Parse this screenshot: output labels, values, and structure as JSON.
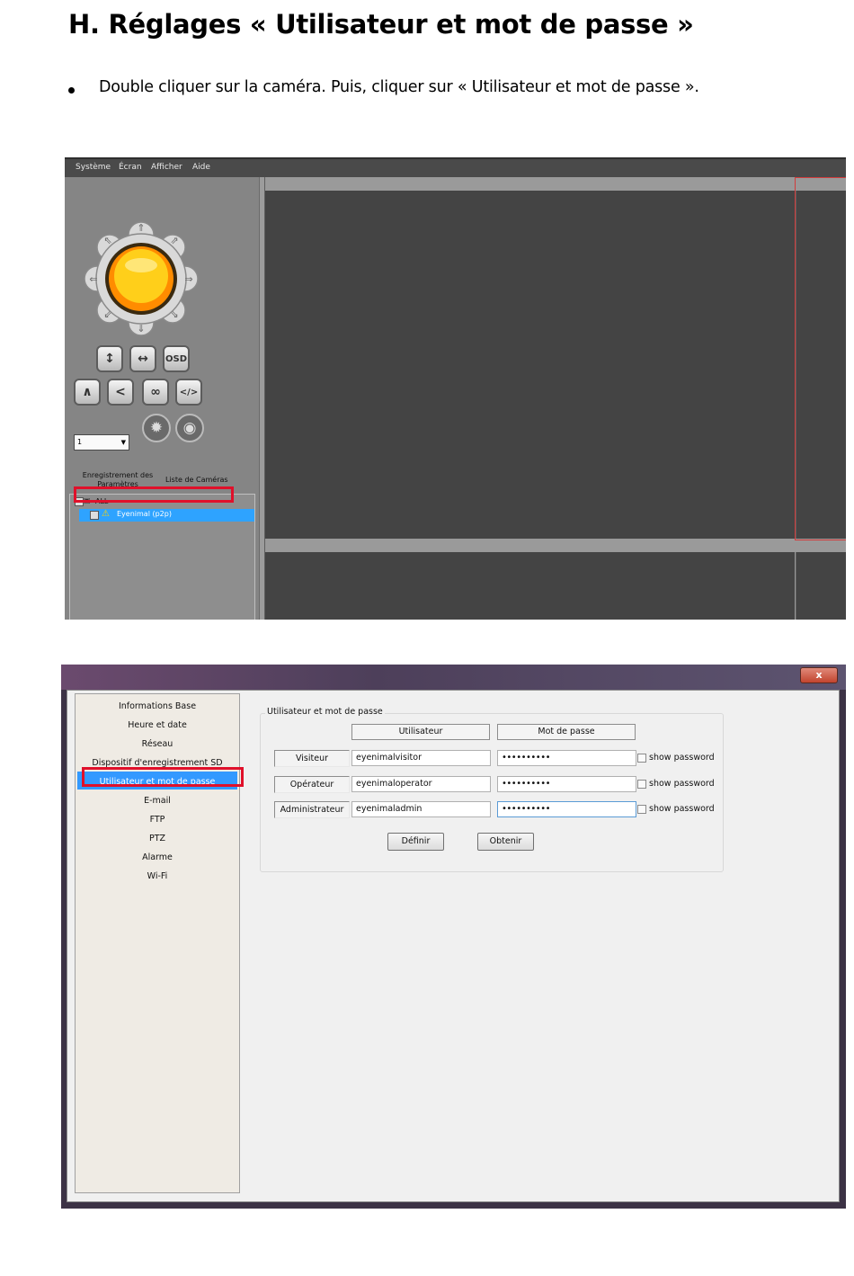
{
  "heading": "H. Réglages « Utilisateur et mot de passe »",
  "instruction": "Double cliquer sur la caméra. Puis, cliquer sur « Utilisateur et mot de passe ».",
  "main_window": {
    "menu": [
      "Système",
      "Écran",
      "Afficher",
      "Aide"
    ],
    "ptz_buttons": [
      "up",
      "down",
      "left",
      "right",
      "up-left",
      "up-right",
      "down-left",
      "down-right"
    ],
    "tool_buttons": {
      "vertical_flip": "↕",
      "horizontal_flip": "↔",
      "osd": "OSD",
      "cruise": "∧",
      "back": "<",
      "loop": "∞",
      "code": "</>"
    },
    "preset_value": "1",
    "tabs": {
      "recording": "Enregistrement des Paramètres",
      "cameras": "Liste de Caméras"
    },
    "tree": {
      "root": "ALL",
      "camera": "Eyenimal (p2p)"
    }
  },
  "settings_dialog": {
    "close_label": "x",
    "nav_items": [
      "Informations Base",
      "Heure et date",
      "Réseau",
      "Dispositif d'enregistrement SD",
      "Utilisateur et mot de passe",
      "E-mail",
      "FTP",
      "PTZ",
      "Alarme",
      "Wi-Fi"
    ],
    "selected_nav": "Utilisateur et mot de passe",
    "group_title": "Utilisateur et mot de passe",
    "col_user": "Utilisateur",
    "col_password": "Mot de passe",
    "rows": [
      {
        "role": "Visiteur",
        "user": "eyenimalvisitor",
        "password": "••••••••••",
        "show_label": "show password"
      },
      {
        "role": "Opérateur",
        "user": "eyenimaloperator",
        "password": "••••••••••",
        "show_label": "show password"
      },
      {
        "role": "Administrateur",
        "user": "eyenimaladmin",
        "password": "••••••••••",
        "show_label": "show password"
      }
    ],
    "btn_set": "Définir",
    "btn_get": "Obtenir"
  },
  "colors": {
    "highlight": "#e0102a",
    "selection": "#3399ff"
  }
}
